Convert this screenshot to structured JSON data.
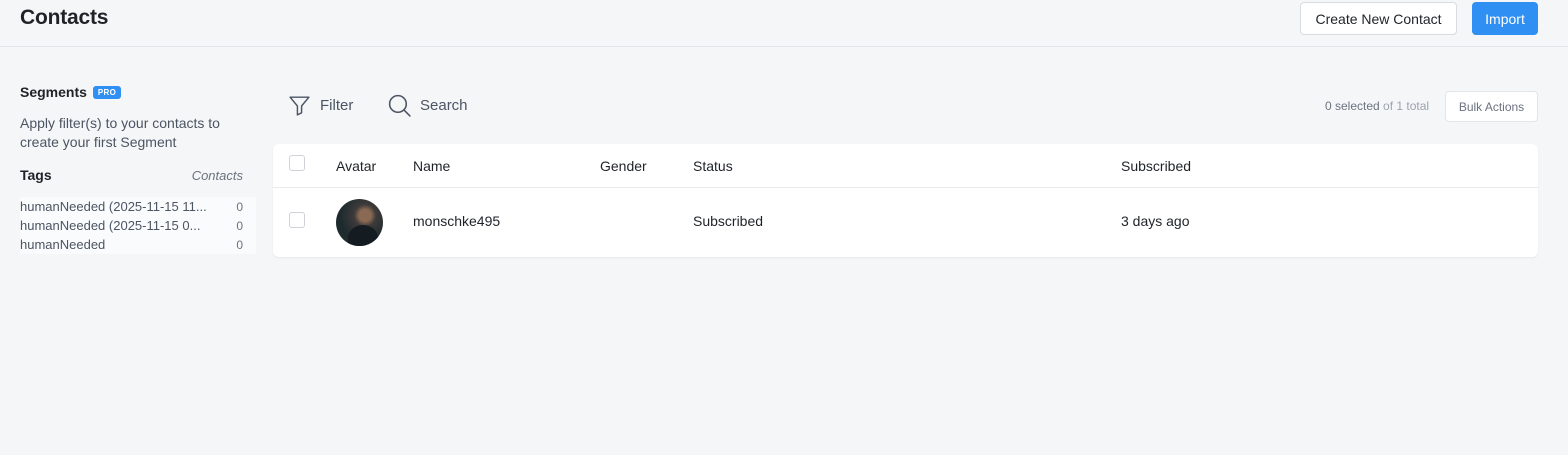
{
  "header": {
    "title": "Contacts",
    "create_button": "Create New Contact",
    "import_button": "Import"
  },
  "sidebar": {
    "segments_title": "Segments",
    "pro_badge": "PRO",
    "segments_description": "Apply filter(s) to your contacts to create your first Segment",
    "tags_title": "Tags",
    "tags_contacts_label": "Contacts",
    "tags": [
      {
        "name": "humanNeeded (2025-11-15 11...",
        "count": "0"
      },
      {
        "name": "humanNeeded (2025-11-15 0...",
        "count": "0"
      },
      {
        "name": "humanNeeded",
        "count": "0"
      }
    ]
  },
  "toolbar": {
    "filter_label": "Filter",
    "search_label": "Search",
    "selected_text": "0 selected",
    "of_total_text": "of 1 total",
    "bulk_actions": "Bulk Actions"
  },
  "table": {
    "columns": [
      "Avatar",
      "Name",
      "Gender",
      "Status",
      "Subscribed"
    ],
    "rows": [
      {
        "name": "monschke495",
        "gender": "",
        "status": "Subscribed",
        "subscribed": "3 days ago"
      }
    ]
  },
  "colors": {
    "accent": "#2f8ff2",
    "background": "#f5f6f8"
  },
  "icons": {
    "filter": "filter-icon",
    "search": "search-icon"
  }
}
